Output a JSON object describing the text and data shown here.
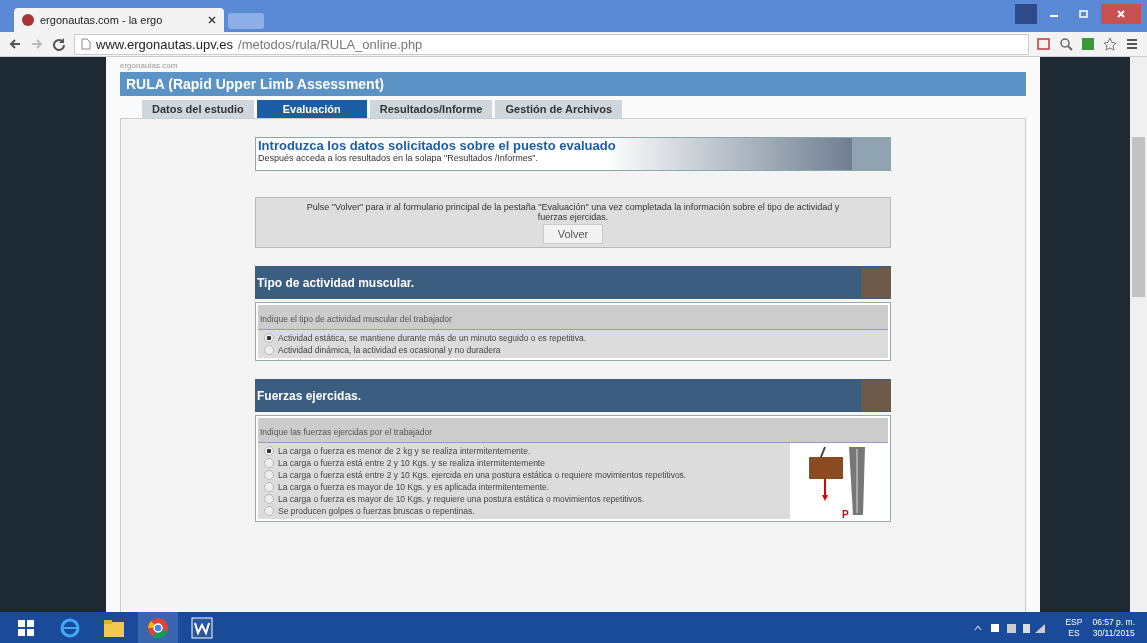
{
  "browser": {
    "tab_title": "ergonautas.com - la ergo",
    "url_host": "www.ergonautas.upv.es",
    "url_path": "/metodos/rula/RULA_online.php"
  },
  "site": {
    "brand": "ergonautas.com",
    "title": "RULA (Rapid Upper Limb Assessment)"
  },
  "tabs": [
    {
      "label": "Datos del estudio",
      "selected": false
    },
    {
      "label": "Evaluación",
      "selected": true
    },
    {
      "label": "Resultados/Informe",
      "selected": false
    },
    {
      "label": "Gestión de Archivos",
      "selected": false
    }
  ],
  "intro": {
    "title": "Introduzca los datos solicitados sobre el puesto evaluado",
    "subtitle": "Después acceda a los resultados en la solapa \"Resultados /Informes\"."
  },
  "notice": {
    "text": "Pulse \"Volver\" para ir al formulario principal de la pestaña \"Evaluación\" una vez completada la información sobre el tipo de actividad y fuerzas ejercidas.",
    "button": "Volver"
  },
  "sections": [
    {
      "title": "Tipo de actividad muscular.",
      "prompt": "Indique el tipo de actividad muscular del trabajador",
      "options": [
        {
          "label": "Actividad estática, se mantiene durante más de un minuto seguido o es repetitiva.",
          "selected": true
        },
        {
          "label": "Actividad dinámica, la actividad es ocasional y no duradera",
          "selected": false
        }
      ]
    },
    {
      "title": "Fuerzas ejercidas.",
      "prompt": "Indique las fuerzas ejercidas por el trabajador",
      "figure_label": "P",
      "options": [
        {
          "label": "La carga o fuerza es menor de 2 kg y se realiza intermitentemente.",
          "selected": true
        },
        {
          "label": "La carga o fuerza está entre 2 y 10 Kgs. y se realiza intermitentemente",
          "selected": false
        },
        {
          "label": "La carga o fuerza está entre 2 y 10 Kgs. ejercida en una postura estática o requiere movimientos repetitivos.",
          "selected": false
        },
        {
          "label": "La carga o fuerza es mayor de 10 Kgs. y es aplicada intermitentemente.",
          "selected": false
        },
        {
          "label": "La carga o fuerza es mayor de 10 Kgs. y requiere una postura estática o movimientos repetitivos.",
          "selected": false
        },
        {
          "label": "Se producen golpes o fuerzas bruscas o repentinas.",
          "selected": false
        }
      ]
    }
  ],
  "taskbar": {
    "lang_top": "ESP",
    "lang_bottom": "ES",
    "time": "06:57 p. m.",
    "date": "30/11/2015"
  }
}
